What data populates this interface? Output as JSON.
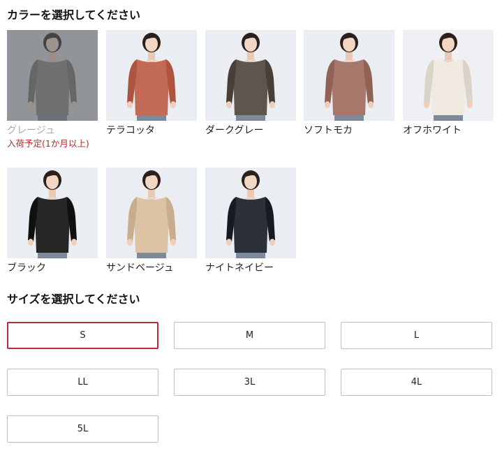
{
  "color_section": {
    "title": "カラーを選択してください",
    "swatches": [
      {
        "name": "グレージュ",
        "shirt_color": "#8c8580",
        "bg": "#d5d6d8",
        "note": "入荷予定(1か月以上)",
        "disabled": true
      },
      {
        "name": "テラコッタ",
        "shirt_color": "#c36a57",
        "bg": "#eaedf1"
      },
      {
        "name": "ダークグレー",
        "shirt_color": "#5e564d",
        "bg": "#eaedf1"
      },
      {
        "name": "ソフトモカ",
        "shirt_color": "#a6776a",
        "bg": "#eaedf1"
      },
      {
        "name": "オフホワイト",
        "shirt_color": "#efe9df",
        "bg": "#eef0f3"
      },
      {
        "name": "ブラック",
        "shirt_color": "#262626",
        "bg": "#eaedf1"
      },
      {
        "name": "サンドベージュ",
        "shirt_color": "#ddc3a4",
        "bg": "#eaedf1"
      },
      {
        "name": "ナイトネイビー",
        "shirt_color": "#2c3038",
        "bg": "#eaedf1"
      }
    ]
  },
  "size_section": {
    "title": "サイズを選択してください",
    "sizes": [
      "S",
      "M",
      "L",
      "LL",
      "3L",
      "4L",
      "5L"
    ],
    "selected": "S"
  },
  "colors": {
    "accent": "#b52b3b",
    "stock_note": "#b52b2b",
    "border": "#bfbfbf"
  }
}
